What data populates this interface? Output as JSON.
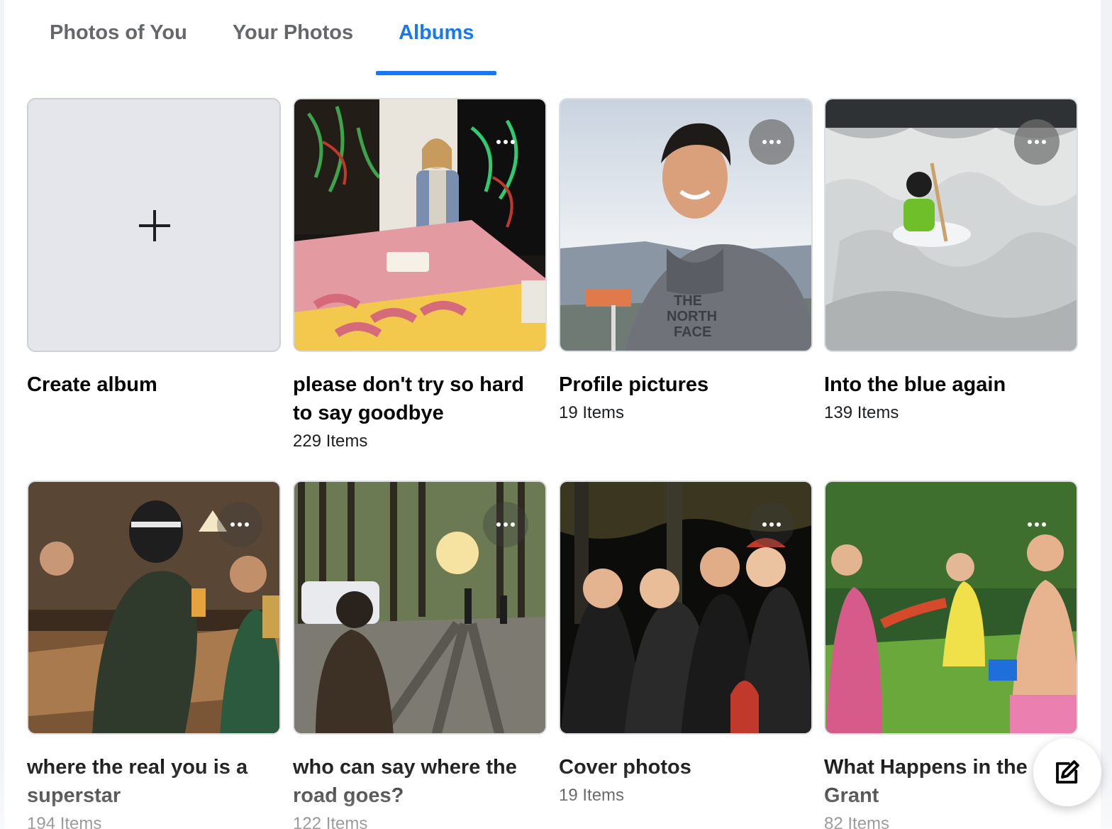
{
  "tabs": [
    {
      "label": "Photos of You",
      "active": false
    },
    {
      "label": "Your Photos",
      "active": false
    },
    {
      "label": "Albums",
      "active": true
    }
  ],
  "create_album": {
    "label": "Create album"
  },
  "albums": [
    {
      "title": "please don't try so hard to say goodbye",
      "count": "229 Items"
    },
    {
      "title": "Profile pictures",
      "count": "19 Items"
    },
    {
      "title": "Into the blue again",
      "count": "139 Items"
    },
    {
      "title": "where the real you is a superstar",
      "count": "194 Items"
    },
    {
      "title": "who can say where the road goes?",
      "count": "122 Items"
    },
    {
      "title": "Cover photos",
      "count": "19 Items"
    },
    {
      "title": "What Happens in the Grant",
      "count": "82 Items"
    }
  ],
  "icons": {
    "create": "plus-icon",
    "more": "more-options-icon",
    "compose": "compose-edit-icon"
  },
  "colors": {
    "accent": "#1877f2",
    "tab_inactive": "#65676b",
    "placeholder": "#e4e6eb"
  }
}
